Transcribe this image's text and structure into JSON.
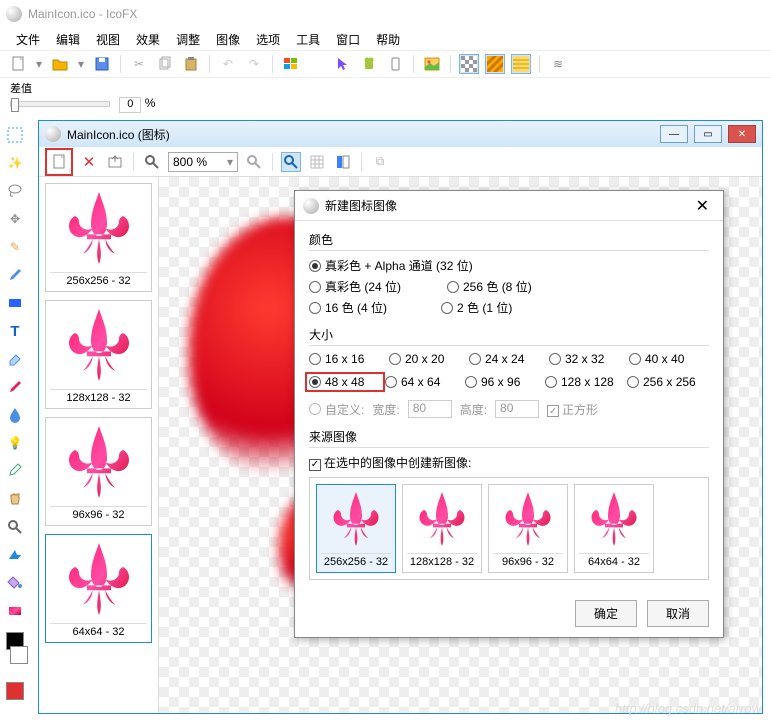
{
  "app": {
    "title": "MainIcon.ico - IcoFX"
  },
  "menu": [
    "文件",
    "编辑",
    "视图",
    "效果",
    "调整",
    "图像",
    "选项",
    "工具",
    "窗口",
    "帮助"
  ],
  "slider": {
    "label": "差值",
    "value": "0",
    "unit": "%"
  },
  "doc": {
    "title": "MainIcon.ico (图标)",
    "zoom": "800 %",
    "thumbs": [
      {
        "label": "256x256 - 32"
      },
      {
        "label": "128x128 - 32"
      },
      {
        "label": "96x96 - 32"
      },
      {
        "label": "64x64 - 32"
      }
    ],
    "selected_thumb": 3
  },
  "dialog": {
    "title": "新建图标图像",
    "color_section": "颜色",
    "colors": [
      {
        "label": "真彩色 + Alpha 通道 (32 位)",
        "checked": true
      },
      {
        "label": "真彩色 (24 位)",
        "checked": false
      },
      {
        "label": "256 色 (8 位)",
        "checked": false
      },
      {
        "label": "16 色 (4 位)",
        "checked": false
      },
      {
        "label": "2 色 (1 位)",
        "checked": false
      }
    ],
    "size_section": "大小",
    "sizes": [
      "16 x 16",
      "20 x 20",
      "24 x 24",
      "32 x 32",
      "40 x 40",
      "48 x 48",
      "64 x 64",
      "96 x 96",
      "128 x 128",
      "256 x 256"
    ],
    "size_selected": 5,
    "custom_label": "自定义:",
    "width_label": "宽度:",
    "height_label": "高度:",
    "width_val": "80",
    "height_val": "80",
    "square_label": "正方形",
    "source_section": "来源图像",
    "source_check": "在选中的图像中创建新图像:",
    "source_thumbs": [
      "256x256 - 32",
      "128x128 - 32",
      "96x96 - 32",
      "64x64 - 32"
    ],
    "source_selected": 0,
    "ok": "确定",
    "cancel": "取消"
  },
  "watermark": "http://blog.csdn.net/arrow"
}
